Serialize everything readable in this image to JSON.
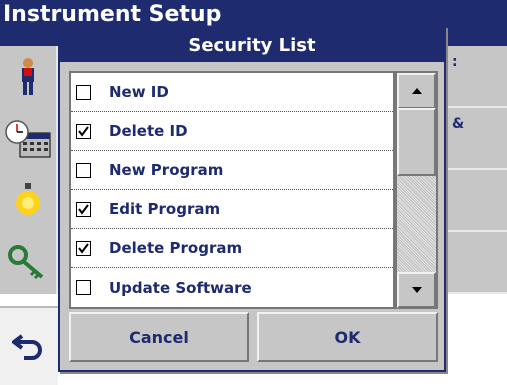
{
  "background_screen": {
    "title": "Instrument Setup",
    "rows": [
      {
        "icon": "operator-id-icon",
        "right_text": ":"
      },
      {
        "icon": "date-time-icon",
        "right_text": "&"
      },
      {
        "icon": "lamp-icon",
        "right_text": ""
      },
      {
        "icon": "key-icon",
        "right_text": ""
      }
    ],
    "back_icon": "back-arrow-icon"
  },
  "dialog": {
    "title": "Security List",
    "items": [
      {
        "label": "New ID",
        "checked": false
      },
      {
        "label": "Delete ID",
        "checked": true
      },
      {
        "label": "New Program",
        "checked": false
      },
      {
        "label": "Edit Program",
        "checked": true
      },
      {
        "label": "Delete Program",
        "checked": true
      },
      {
        "label": "Update Software",
        "checked": false
      }
    ],
    "scroll_up_icon": "up-arrow-icon",
    "scroll_down_icon": "down-arrow-icon",
    "cancel_label": "Cancel",
    "ok_label": "OK"
  },
  "colors": {
    "header": "#1e2b6f",
    "panel": "#c6c6c6",
    "text": "#1e2b6f"
  }
}
